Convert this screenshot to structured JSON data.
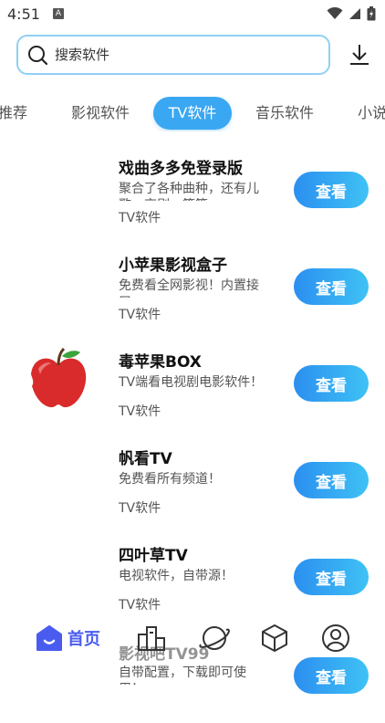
{
  "status_bar": {
    "time": "4:51",
    "notif_glyph": "A"
  },
  "search": {
    "placeholder": "搜索软件"
  },
  "tabs": [
    {
      "label": "推荐",
      "active": false
    },
    {
      "label": "影视软件",
      "active": false
    },
    {
      "label": "TV软件",
      "active": true
    },
    {
      "label": "音乐软件",
      "active": false
    },
    {
      "label": "小说",
      "active": false
    }
  ],
  "items": [
    {
      "title": "戏曲多多免登录版",
      "desc": "聚合了各种曲种，还有儿歌、京剧、等等。",
      "category": "TV软件",
      "button": "查看",
      "icon": "none"
    },
    {
      "title": "小苹果影视盒子",
      "desc": "免费看全网影视！内置接口。",
      "category": "TV软件",
      "button": "查看",
      "icon": "none"
    },
    {
      "title": "毒苹果BOX",
      "desc": "TV端看电视剧电影软件！",
      "category": "TV软件",
      "button": "查看",
      "icon": "red-apple-icon"
    },
    {
      "title": "帆看TV",
      "desc": "免费看所有频道！",
      "category": "TV软件",
      "button": "查看",
      "icon": "none"
    },
    {
      "title": "四叶草TV",
      "desc": "电视软件，自带源！",
      "category": "TV软件",
      "button": "查看",
      "icon": "none"
    },
    {
      "title": "影视吧TV99",
      "desc": "自带配置，下载即可使用！",
      "category": "",
      "button": "查看",
      "icon": "none"
    }
  ],
  "bottom_nav": {
    "home_label": "首页",
    "items": [
      "home-icon",
      "rank-icon",
      "planet-icon",
      "cube-icon",
      "profile-icon"
    ],
    "accent": "#4a5cf0"
  },
  "colors": {
    "accent": "#3aa7f2",
    "button_gradient": [
      "#2b8ff0",
      "#3fc2f5"
    ],
    "search_border": "#8fd0f4"
  }
}
